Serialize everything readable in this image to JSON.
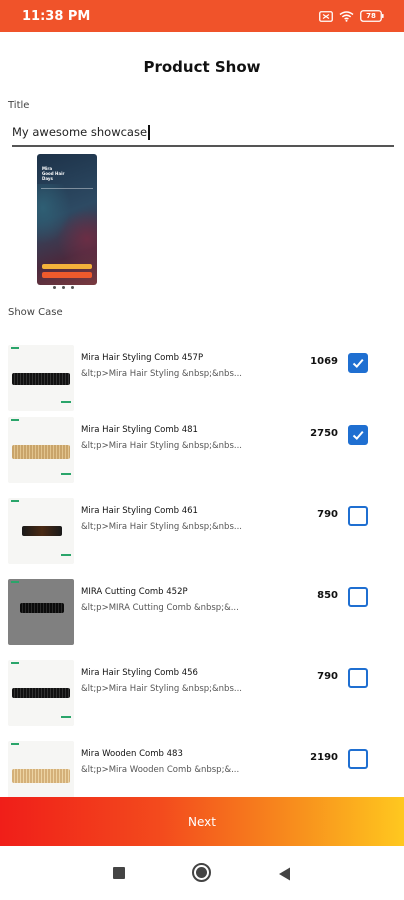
{
  "status_bar": {
    "time": "11:38 PM",
    "battery": "78",
    "icons": [
      "sim-icon",
      "wifi-icon",
      "battery-icon"
    ]
  },
  "header": {
    "title": "Product Show"
  },
  "form": {
    "title_label": "Title",
    "title_value": "My awesome showcase"
  },
  "preview": {
    "text": "Mira\nGood Hair\nDays",
    "page_count": 3
  },
  "showcase": {
    "label": "Show Case",
    "products": [
      {
        "name": "Mira Hair Styling Comb 457P",
        "desc": "&lt;p>Mira Hair Styling &nbsp;&nbs...",
        "price": "1069",
        "checked": true
      },
      {
        "name": "Mira Hair Styling Comb 481",
        "desc": "&lt;p>Mira Hair Styling &nbsp;&nbs...",
        "price": "2750",
        "checked": true
      },
      {
        "name": "Mira Hair Styling Comb 461",
        "desc": "&lt;p>Mira Hair Styling &nbsp;&nbs...",
        "price": "790",
        "checked": false
      },
      {
        "name": "MIRA Cutting Comb 452P",
        "desc": "&lt;p>MIRA Cutting Comb &nbsp;&...",
        "price": "850",
        "checked": false
      },
      {
        "name": "Mira Hair Styling Comb 456",
        "desc": "&lt;p>Mira Hair Styling &nbsp;&nbs...",
        "price": "790",
        "checked": false
      },
      {
        "name": "Mira Wooden Comb 483",
        "desc": "&lt;p>Mira Wooden Comb &nbsp;&...",
        "price": "2190",
        "checked": false
      }
    ]
  },
  "footer": {
    "next_label": "Next"
  },
  "colors": {
    "status_bar": "#f0532a",
    "checkbox": "#1f6fd1",
    "gradient_start": "#f01e19",
    "gradient_end": "#ffc81f"
  }
}
